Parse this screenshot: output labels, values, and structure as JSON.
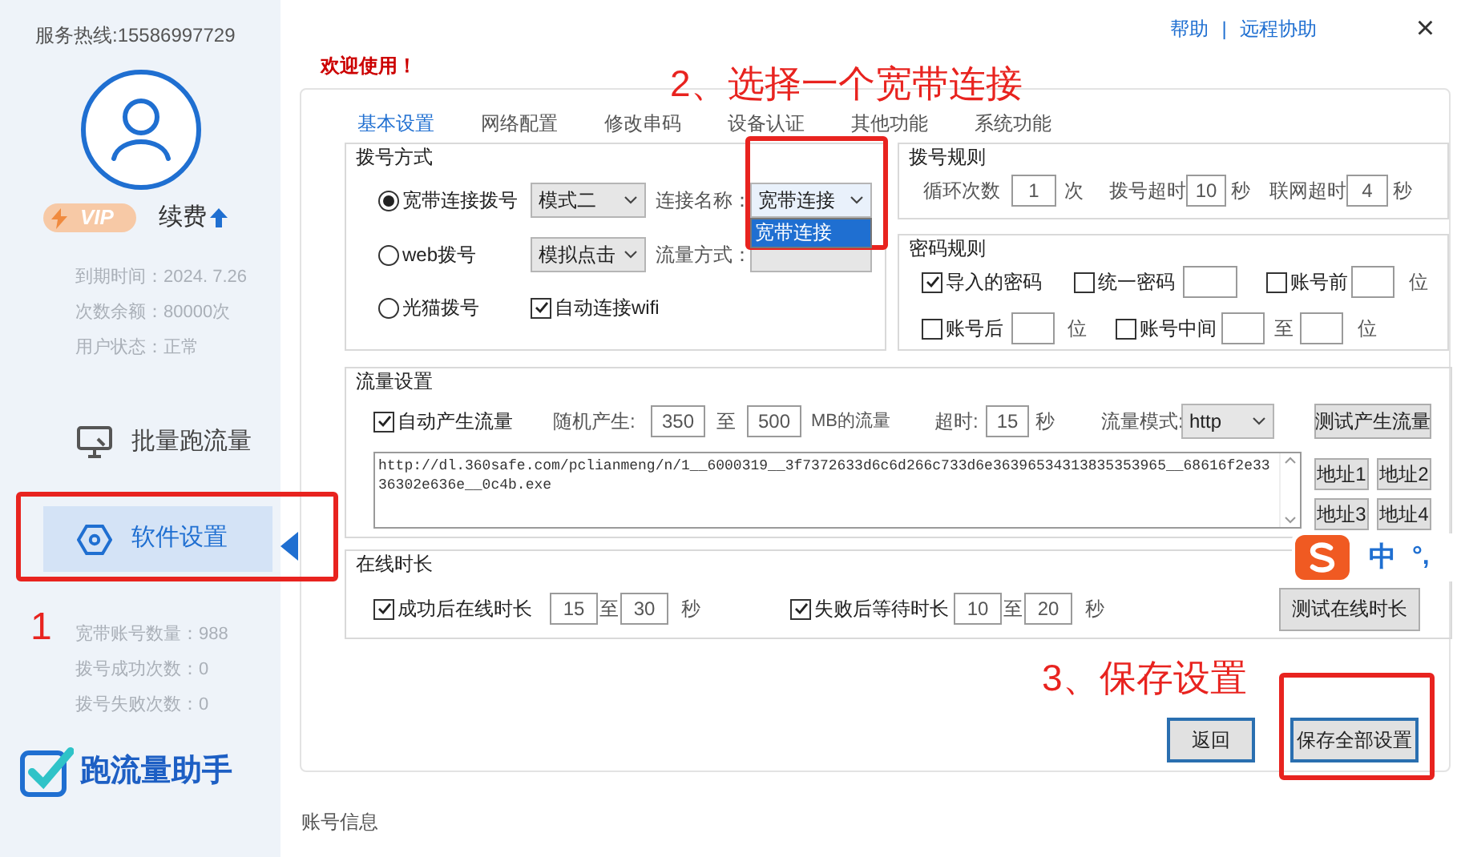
{
  "sidebar": {
    "hotline": "服务热线:15586997729",
    "vip_badge": "VIP",
    "renew": "续费",
    "account_info": [
      "到期时间：2024. 7.26",
      "次数余额：80000次",
      "用户状态：正常"
    ],
    "menu": [
      {
        "label": "批量跑流量",
        "kind": "monitor",
        "selected": false
      },
      {
        "label": "软件设置",
        "kind": "hexagon",
        "selected": true
      }
    ],
    "stats": [
      "宽带账号数量：988",
      "拨号成功次数：0",
      "拨号失败次数：0"
    ],
    "logo": "跑流量助手"
  },
  "header": {
    "links": [
      "帮助",
      "远程协助"
    ],
    "separator": "|",
    "close": "×",
    "welcome": "欢迎使用！"
  },
  "tabs": [
    {
      "label": "基本设置",
      "selected": true
    },
    {
      "label": "网络配置",
      "selected": false
    },
    {
      "label": "修改串码",
      "selected": false
    },
    {
      "label": "设备认证",
      "selected": false
    },
    {
      "label": "其他功能",
      "selected": false
    },
    {
      "label": "系统功能",
      "selected": false
    }
  ],
  "dial_mode": {
    "title": "拨号方式",
    "options": [
      {
        "label": "宽带连接拨号",
        "selected": true
      },
      {
        "label": "web拨号",
        "selected": false
      },
      {
        "label": "光猫拨号",
        "selected": false
      }
    ],
    "mode_select": "模式二",
    "click_select": "模拟点击",
    "connection_label": "连接名称：",
    "connection_value": "宽带连接",
    "connection_dropdown": {
      "expanded": true,
      "options": [
        {
          "label": "宽带连接",
          "selected": true
        }
      ]
    },
    "flow_label": "流量方式：",
    "auto_wifi": {
      "label": "自动连接wifi",
      "checked": true
    }
  },
  "dial_rules": {
    "title": "拨号规则",
    "retry_label": "循环次数",
    "retry_value": "1",
    "retry_unit": "次",
    "dial_timeout_label": "拨号超时",
    "dial_timeout_value": "10",
    "dial_timeout_unit": "秒",
    "net_timeout_label": "联网超时",
    "net_timeout_value": "4",
    "net_timeout_unit": "秒"
  },
  "password_rules": {
    "title": "密码规则",
    "imported": {
      "label": "导入的密码",
      "checked": true
    },
    "unified": {
      "label": "统一密码",
      "checked": false
    },
    "prefix": {
      "label": "账号前",
      "checked": false,
      "unit": "位"
    },
    "suffix": {
      "label": "账号后",
      "checked": false,
      "unit": "位"
    },
    "middle": {
      "label": "账号中间",
      "checked": false,
      "to": "至",
      "unit": "位"
    }
  },
  "traffic": {
    "title": "流量设置",
    "auto": {
      "label": "自动产生流量",
      "checked": true
    },
    "random_label": "随机产生:",
    "min": "350",
    "to": "至",
    "max": "500",
    "mb_label": "MB的流量",
    "timeout_label": "超时:",
    "timeout": "15",
    "timeout_unit": "秒",
    "mode_label": "流量模式:",
    "mode": "http",
    "test_button": "测试产生流量",
    "url": "http://dl.360safe.com/pclianmeng/n/1__6000319__3f7372633d6c6d266c733d6e36396534313835353965__68616f2e3336302e636e__0c4b.exe",
    "address_buttons": [
      "地址1",
      "地址2",
      "地址3",
      "地址4"
    ]
  },
  "online": {
    "title": "在线时长",
    "success": {
      "label": "成功后在线时长",
      "checked": true,
      "min": "15",
      "to": "至",
      "max": "30",
      "unit": "秒"
    },
    "failure": {
      "label": "失败后等待时长",
      "checked": true,
      "min": "10",
      "to": "至",
      "max": "20",
      "unit": "秒"
    },
    "test_button": "测试在线时长"
  },
  "actions": {
    "back": "返回",
    "save": "保存全部设置"
  },
  "footer": "账号信息",
  "annotations": [
    {
      "text": "1"
    },
    {
      "text": "2、选择一个宽带连接"
    },
    {
      "text": "3、保存设置"
    }
  ],
  "ime_toolbar": {
    "items": [
      "中",
      "°,"
    ]
  }
}
